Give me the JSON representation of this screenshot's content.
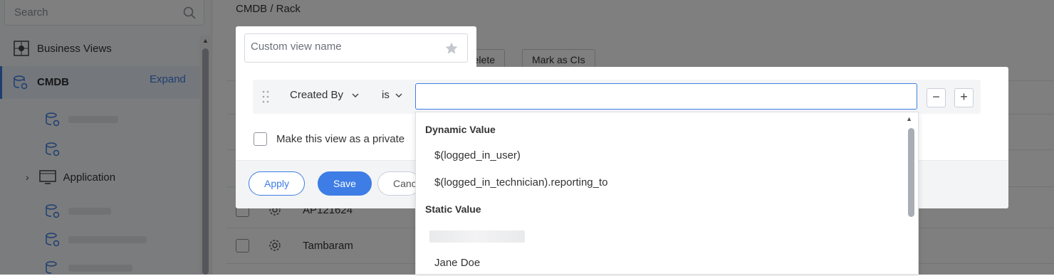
{
  "sidebar": {
    "search_placeholder": "Search",
    "business_views": "Business Views",
    "cmdb": "CMDB",
    "expand": "Expand",
    "application": "Application"
  },
  "main": {
    "breadcrumb": "CMDB /  Rack",
    "toolbar": {
      "delete_label": "Delete",
      "mark_label": "Mark as CIs"
    },
    "rows": [
      {
        "name": "AP121624"
      },
      {
        "name": "Tambaram"
      }
    ]
  },
  "popup": {
    "view_name_placeholder": "Custom view name",
    "criteria": {
      "field": "Created By",
      "operator": "is",
      "value": ""
    },
    "private_label": "Make this view as a private",
    "apply": "Apply",
    "save": "Save",
    "cancel": "Cancel"
  },
  "dropdown": {
    "dynamic_header": "Dynamic Value",
    "dynamic_options": [
      "$(logged_in_user)",
      "$(logged_in_technician).reporting_to"
    ],
    "static_header": "Static Value",
    "static_options": [
      "Jane Doe"
    ]
  },
  "colors": {
    "accent": "#3d7de5",
    "overlay": "rgba(0,0,0,0.5)"
  }
}
